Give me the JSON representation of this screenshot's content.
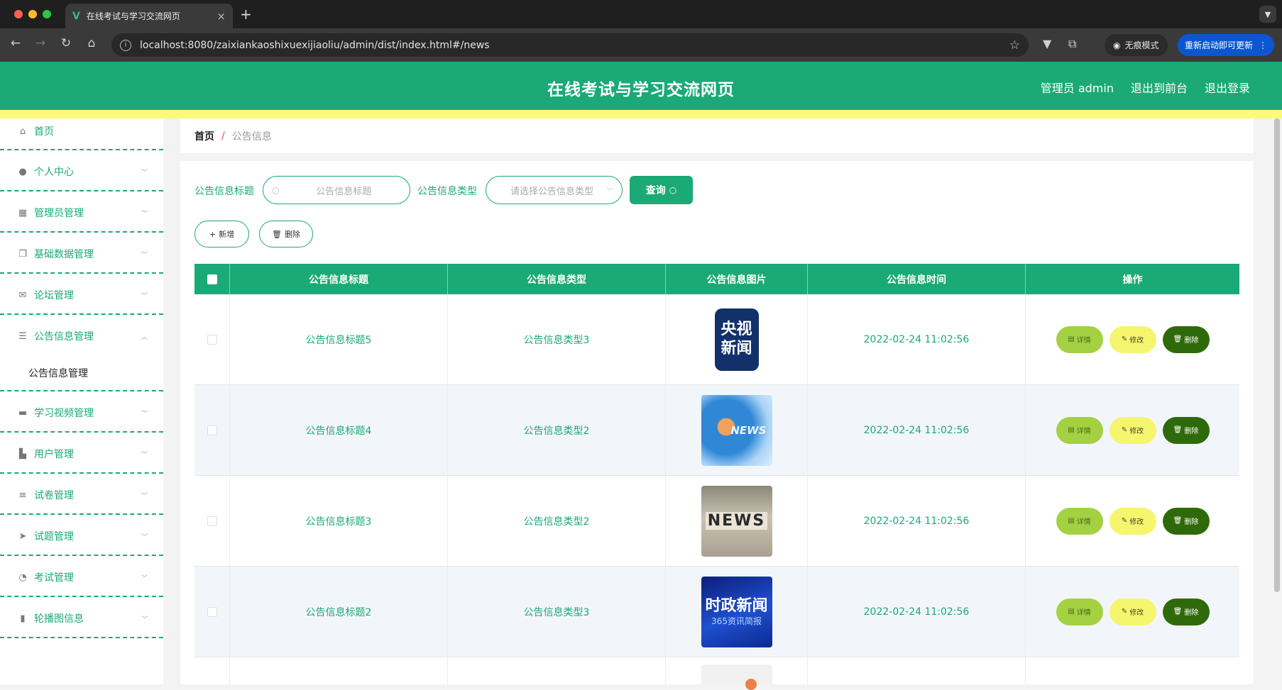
{
  "browser": {
    "tab_title": "在线考试与学习交流网页",
    "url": "localhost:8080/zaixiankaoshixuexijiaoliu/admin/dist/index.html#/news",
    "incognito_label": "无痕模式",
    "update_label": "重新启动即可更新"
  },
  "header": {
    "title": "在线考试与学习交流网页",
    "user_label": "管理员 admin",
    "front_label": "退出到前台",
    "logout_label": "退出登录"
  },
  "sidebar": {
    "items": [
      {
        "label": "首页",
        "icon": "home-icon"
      },
      {
        "label": "个人中心",
        "icon": "user-icon"
      },
      {
        "label": "管理员管理",
        "icon": "grid-icon"
      },
      {
        "label": "基础数据管理",
        "icon": "copy-icon"
      },
      {
        "label": "论坛管理",
        "icon": "mail-icon"
      },
      {
        "label": "公告信息管理",
        "icon": "list-icon"
      },
      {
        "label": "学习视频管理",
        "icon": "video-icon"
      },
      {
        "label": "用户管理",
        "icon": "wallet-icon"
      },
      {
        "label": "试卷管理",
        "icon": "menu-icon"
      },
      {
        "label": "试题管理",
        "icon": "send-icon"
      },
      {
        "label": "考试管理",
        "icon": "gauge-icon"
      },
      {
        "label": "轮播图信息",
        "icon": "bar-chart-icon"
      }
    ],
    "subitem": "公告信息管理"
  },
  "breadcrumb": {
    "home": "首页",
    "sep": "/",
    "current": "公告信息"
  },
  "filters": {
    "title_label": "公告信息标题",
    "title_placeholder": "公告信息标题",
    "type_label": "公告信息类型",
    "type_placeholder": "请选择公告信息类型",
    "query_label": "查询"
  },
  "actions": {
    "add_label": "新增",
    "delete_label": "删除"
  },
  "table": {
    "headers": [
      "公告信息标题",
      "公告信息类型",
      "公告信息图片",
      "公告信息时间",
      "操作"
    ],
    "detail_label": "详情",
    "edit_label": "修改",
    "delete_label": "删除",
    "rows": [
      {
        "title": "公告信息标题5",
        "type": "公告信息类型3",
        "image_text": "央视新闻",
        "time": "2022-02-24 11:02:56"
      },
      {
        "title": "公告信息标题4",
        "type": "公告信息类型2",
        "image_text": "NEWS",
        "time": "2022-02-24 11:02:56"
      },
      {
        "title": "公告信息标题3",
        "type": "公告信息类型2",
        "image_text": "NEWS",
        "time": "2022-02-24 11:02:56"
      },
      {
        "title": "公告信息标题2",
        "type": "公告信息类型3",
        "image_text": "时政新闻",
        "image_sub": "365资讯简报",
        "time": "2022-02-24 11:02:56"
      }
    ]
  },
  "colors": {
    "primary": "#1aa977",
    "stripe": "#fef97c",
    "detail": "#a3d142",
    "edit": "#f6f56e",
    "delete": "#2e6a0a"
  }
}
